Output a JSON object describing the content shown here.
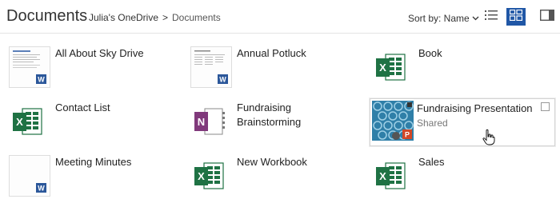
{
  "header": {
    "title": "Documents",
    "breadcrumb_root": "Julia's OneDrive",
    "breadcrumb_sep": ">",
    "breadcrumb_current": "Documents",
    "sort_label": "Sort by: Name",
    "sort_chevron": "⌄"
  },
  "tiles": [
    {
      "name": "All About Sky Drive",
      "icon": "word-document-thumbnail"
    },
    {
      "name": "Annual Potluck",
      "icon": "word-document-thumbnail"
    },
    {
      "name": "Book",
      "icon": "excel-icon"
    },
    {
      "name": "Contact List",
      "icon": "excel-icon"
    },
    {
      "name": "Fundraising Brainstorming",
      "icon": "onenote-icon"
    },
    {
      "name": "Fundraising Presentation",
      "sub": "Shared",
      "icon": "powerpoint-thumbnail",
      "selected": true
    },
    {
      "name": "Meeting Minutes",
      "icon": "word-document-thumbnail"
    },
    {
      "name": "New Workbook",
      "icon": "excel-icon"
    },
    {
      "name": "Sales",
      "icon": "excel-icon"
    }
  ],
  "colors": {
    "accent": "#2057a6",
    "excel": "#1f7244",
    "word": "#2b579a",
    "onenote": "#80397b",
    "powerpoint": "#d24726"
  }
}
